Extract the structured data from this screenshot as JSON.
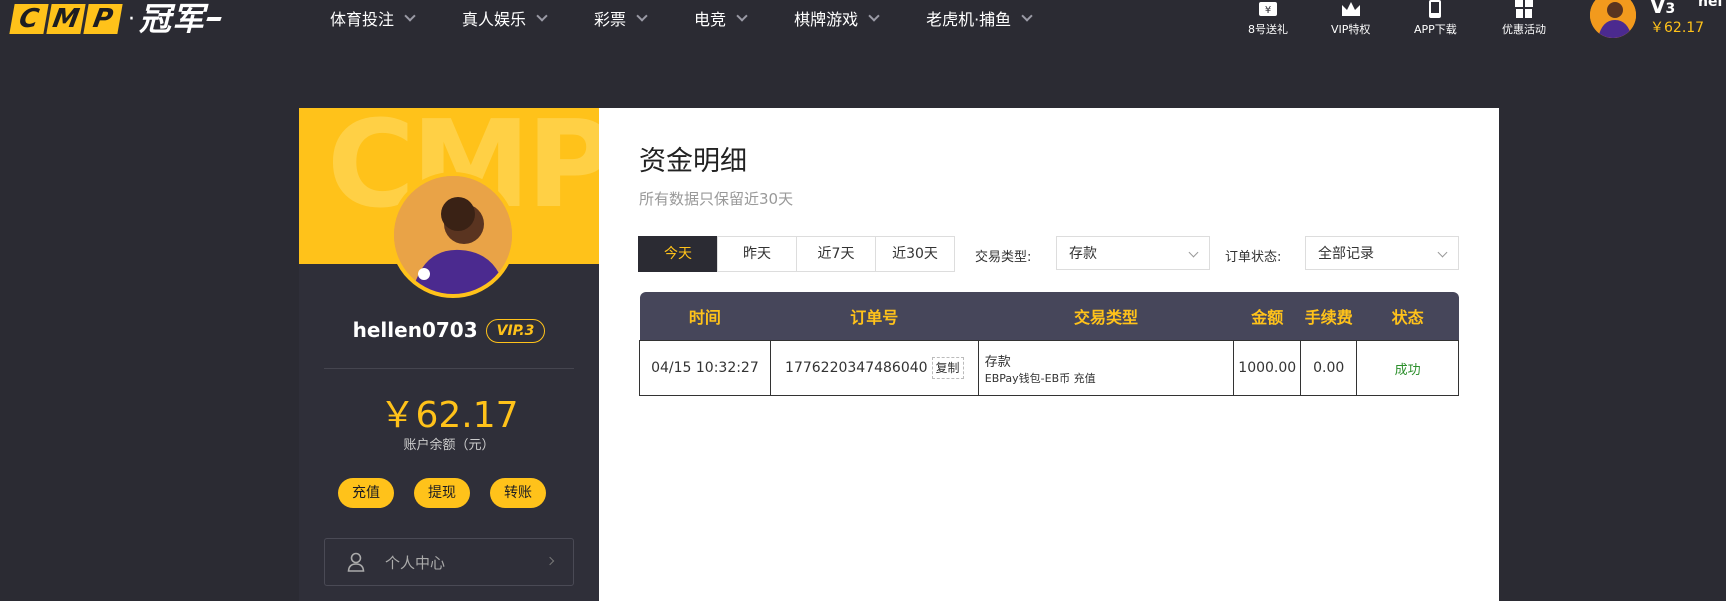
{
  "logo": {
    "cmp_letters": [
      "C",
      "M",
      "P"
    ],
    "dot": "·",
    "cn": "冠军"
  },
  "nav": [
    "体育投注",
    "真人娱乐",
    "彩票",
    "电竞",
    "棋牌游戏",
    "老虎机·捕鱼"
  ],
  "tools": [
    {
      "label": "8号送礼",
      "icon": "gift-ticket-icon"
    },
    {
      "label": "VIP特权",
      "icon": "crown-icon"
    },
    {
      "label": "APP下载",
      "icon": "phone-icon"
    },
    {
      "label": "优惠活动",
      "icon": "gift-box-icon"
    }
  ],
  "header_user": {
    "level": "V",
    "level_num": "3",
    "balance": "￥62.17",
    "name_partial": "hel"
  },
  "sidebar": {
    "watermark": "CMP",
    "username": "hellen0703",
    "vip": "VIP.3",
    "balance": "￥62.17",
    "balance_label": "账户余额（元）",
    "buttons": [
      "充值",
      "提现",
      "转账"
    ],
    "menu_item": "个人中心"
  },
  "main": {
    "title": "资金明细",
    "subtitle": "所有数据只保留近30天",
    "tabs": [
      "今天",
      "昨天",
      "近7天",
      "近30天"
    ],
    "active_tab": "今天",
    "filter_type_label": "交易类型:",
    "filter_type_value": "存款",
    "filter_status_label": "订单状态:",
    "filter_status_value": "全部记录",
    "columns": [
      "时间",
      "订单号",
      "交易类型",
      "金额",
      "手续费",
      "状态"
    ],
    "rows": [
      {
        "time": "04/15 10:32:27",
        "order": "1776220347486040",
        "copy": "复制",
        "type_main": "存款",
        "type_detail": "EBPay钱包-EB币 充值",
        "amount": "1000.00",
        "fee": "0.00",
        "status": "成功"
      }
    ]
  },
  "colors": {
    "accent": "#ffc21a",
    "dark": "#2b2b33",
    "header_row": "#46465a",
    "success": "#2c8f2c"
  }
}
